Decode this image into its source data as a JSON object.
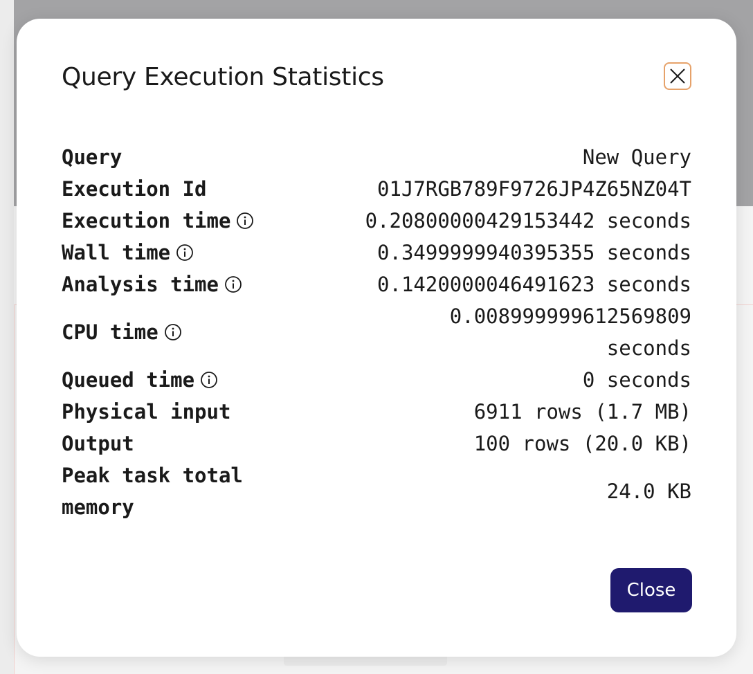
{
  "dialog": {
    "title": "Query Execution Statistics",
    "close_button_label": "Close",
    "close_icon": "close-icon",
    "accent_color": "#1f1a6e",
    "close_icon_border_color": "#e6a26a"
  },
  "stats": [
    {
      "label": "Query",
      "value": "New Query",
      "info": false
    },
    {
      "label": "Execution Id",
      "value": "01J7RGB789F9726JP4Z65NZ04T",
      "info": false
    },
    {
      "label": "Execution time",
      "value": "0.20800000429153442 seconds",
      "info": true
    },
    {
      "label": "Wall time",
      "value": "0.3499999940395355 seconds",
      "info": true
    },
    {
      "label": "Analysis time",
      "value": "0.1420000046491623 seconds",
      "info": true
    },
    {
      "label": "CPU time",
      "value": "0.008999999612569809 seconds",
      "info": true
    },
    {
      "label": "Queued time",
      "value": "0 seconds",
      "info": true
    },
    {
      "label": "Physical input",
      "value": "6911 rows (1.7 MB)",
      "info": false
    },
    {
      "label": "Output",
      "value": "100 rows (20.0 KB)",
      "info": false
    },
    {
      "label": "Peak task total memory",
      "value": "24.0 KB",
      "info": false
    }
  ]
}
